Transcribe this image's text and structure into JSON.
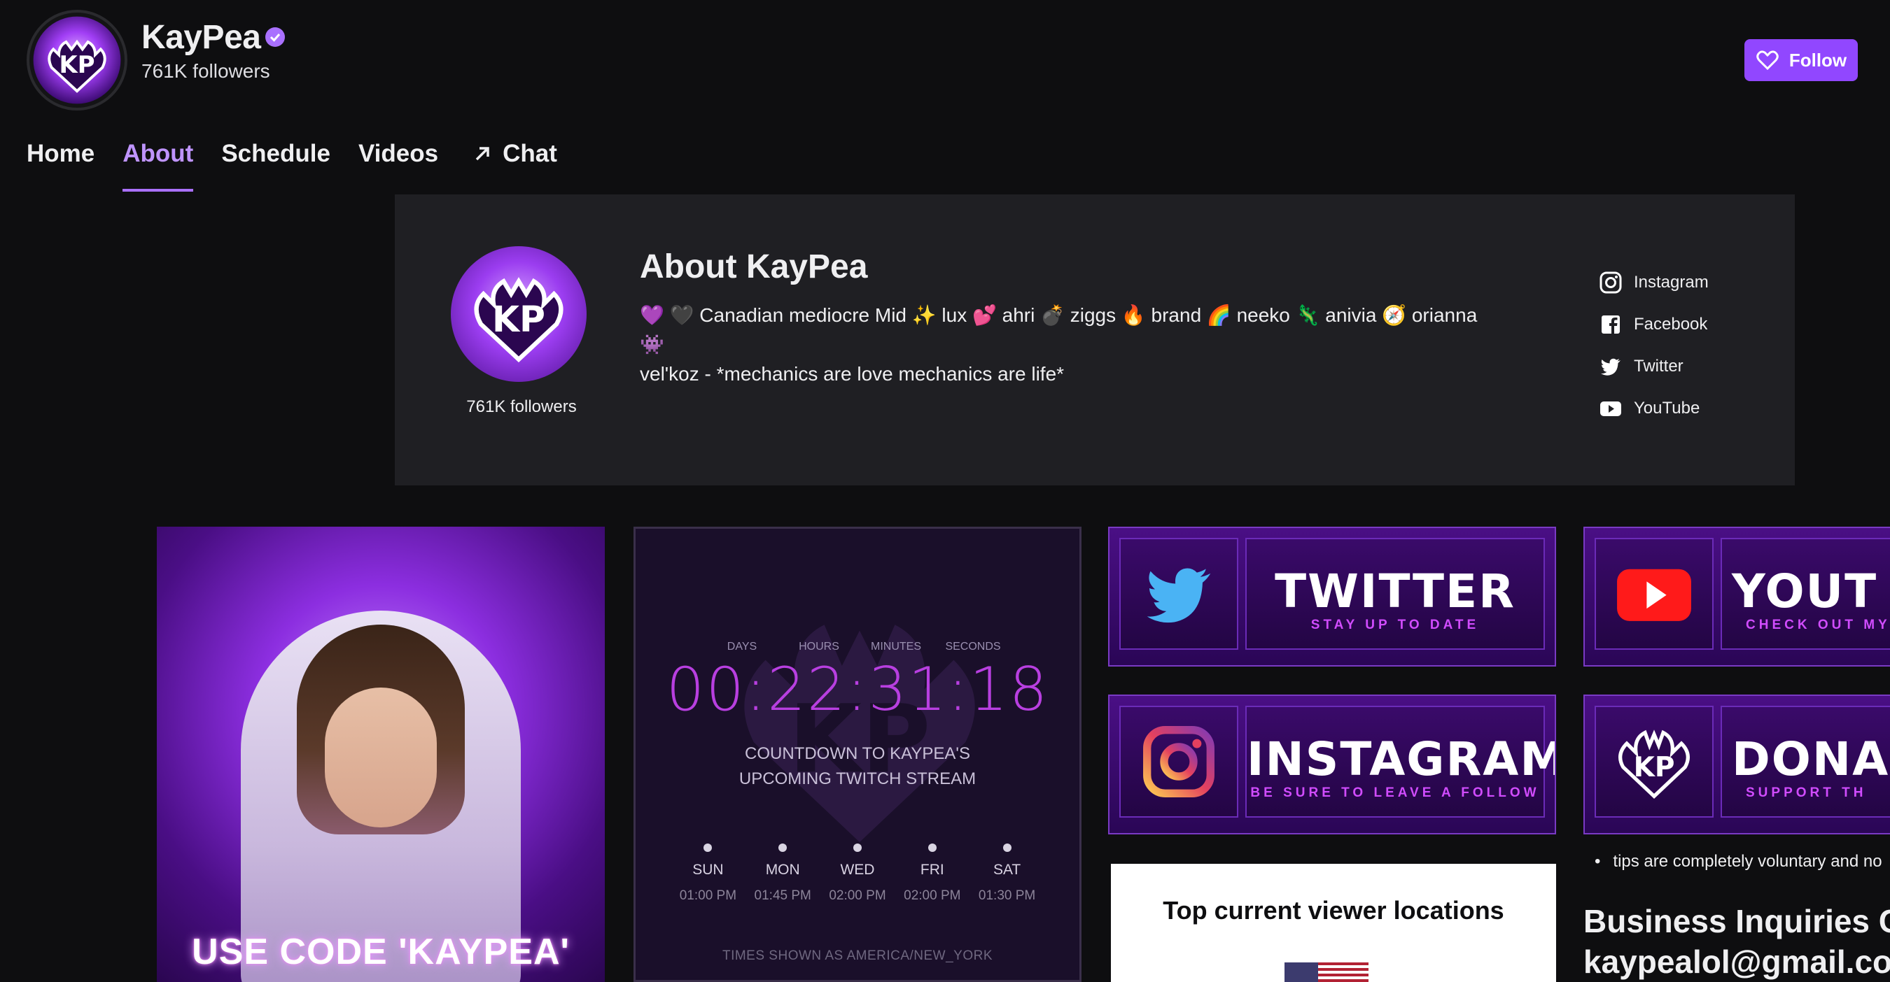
{
  "channel": {
    "name": "KayPea",
    "followers": "761K followers",
    "follow_label": "Follow"
  },
  "nav": {
    "items": [
      {
        "label": "Home"
      },
      {
        "label": "About"
      },
      {
        "label": "Schedule"
      },
      {
        "label": "Videos"
      },
      {
        "label": "Chat"
      }
    ],
    "active": "About"
  },
  "about": {
    "title": "About KayPea",
    "followers": "761K followers",
    "bio_line1": "💜 🖤 Canadian mediocre Mid ✨ lux 💕 ahri 💣 ziggs 🔥 brand 🌈 neeko 🦎 anivia 🧭 orianna 👾",
    "bio_line2": "vel'koz - *mechanics are love mechanics are life*",
    "socials": [
      {
        "label": "Instagram",
        "icon": "instagram-icon"
      },
      {
        "label": "Facebook",
        "icon": "facebook-icon"
      },
      {
        "label": "Twitter",
        "icon": "twitter-icon"
      },
      {
        "label": "YouTube",
        "icon": "youtube-icon"
      }
    ]
  },
  "panels": {
    "promo_text": "USE CODE 'KAYPEA'",
    "countdown": {
      "units": [
        "DAYS",
        "HOURS",
        "MINUTES",
        "SECONDS"
      ],
      "time": "00:22:31:18",
      "title_line1": "COUNTDOWN TO KAYPEA'S",
      "title_line2": "UPCOMING TWITCH STREAM",
      "days": [
        {
          "day": "SUN",
          "time": "01:00 PM"
        },
        {
          "day": "MON",
          "time": "01:45 PM"
        },
        {
          "day": "WED",
          "time": "02:00 PM"
        },
        {
          "day": "FRI",
          "time": "02:00 PM"
        },
        {
          "day": "SAT",
          "time": "01:30 PM"
        }
      ],
      "note": "TIMES SHOWN AS AMERICA/NEW_YORK"
    },
    "twitter": {
      "big": "TWITTER",
      "small": "STAY UP TO DATE"
    },
    "instagram": {
      "big": "INSTAGRAM",
      "small": "BE SURE TO LEAVE A FOLLOW"
    },
    "youtube": {
      "big": "YOUT",
      "small": "CHECK OUT MY L"
    },
    "donate": {
      "big": "DONA",
      "small": "SUPPORT TH"
    },
    "locations_title": "Top current viewer locations",
    "tips": "tips are completely voluntary and no",
    "biz_title": "Business Inquiries C",
    "biz_email": "kaypealol@gmail.co"
  },
  "colors": {
    "accent": "#9147ff",
    "accent_light": "#bf94ff",
    "background": "#0e0e10",
    "panel": "#1f1f23"
  }
}
